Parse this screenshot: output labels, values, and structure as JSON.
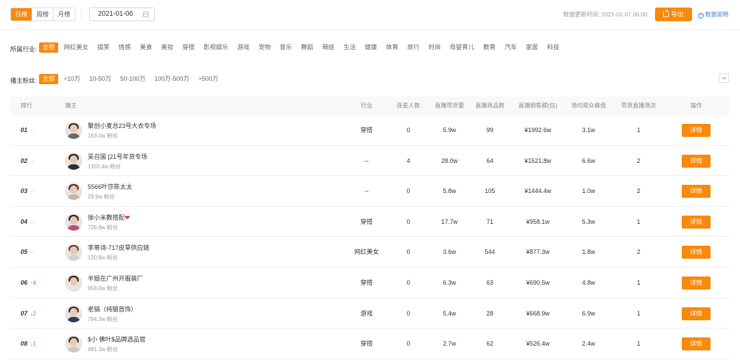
{
  "toolbar": {
    "tabs": [
      {
        "label": "日榜",
        "active": true
      },
      {
        "label": "周榜",
        "active": false
      },
      {
        "label": "月榜",
        "active": false
      }
    ],
    "date": "2021-01-06",
    "update_label": "数据更新时间:",
    "update_time": "2021-01-07 06:00",
    "export_label": "导出",
    "help_label": "数据说明"
  },
  "industry": {
    "label": "所属行业:",
    "options": [
      "全部",
      "网红美女",
      "搞笑",
      "情感",
      "美食",
      "美妆",
      "穿搭",
      "影视娱乐",
      "游戏",
      "宠物",
      "音乐",
      "舞蹈",
      "萌娃",
      "生活",
      "健康",
      "体育",
      "旅行",
      "时尚",
      "母婴育儿",
      "教育",
      "汽车",
      "家居",
      "科技"
    ],
    "selected": "全部"
  },
  "fans": {
    "label": "播主粉丝:",
    "options": [
      "全部",
      "<10万",
      "10-50万",
      "50-100万",
      "100万-500万",
      ">500万"
    ],
    "selected": "全部"
  },
  "table": {
    "headers": {
      "rank": "排行",
      "streamer": "播主",
      "industry": "行业",
      "mic": "连麦人数",
      "goods": "直播带货量",
      "items": "直播商品数",
      "sales": "直播销售额(估)",
      "peak": "场均观众峰值",
      "sessions": "带货直播场次",
      "action": "操作"
    },
    "rows": [
      {
        "rank": "01",
        "trend": "--",
        "trend_dir": "flat",
        "name": "聚创小麦总23号大衣专场",
        "fans": "163.0w 粉丝",
        "industry": "穿搭",
        "mic": "0",
        "goods": "5.9w",
        "items": "99",
        "sales": "¥1992.6w",
        "peak": "3.1w",
        "sessions": "1",
        "action": "详情"
      },
      {
        "rank": "02",
        "trend": "--",
        "trend_dir": "flat",
        "name": "吴召国 [21号年货专场",
        "fans": "1355.4w 粉丝",
        "industry": "--",
        "mic": "4",
        "goods": "28.0w",
        "items": "64",
        "sales": "¥1521.8w",
        "peak": "6.6w",
        "sessions": "2",
        "action": "详情"
      },
      {
        "rank": "03",
        "trend": "--",
        "trend_dir": "flat",
        "name": "5566叶莎陈太太",
        "fans": "29.9w 粉丝",
        "industry": "--",
        "mic": "0",
        "goods": "5.8w",
        "items": "105",
        "sales": "¥1444.4w",
        "peak": "1.0w",
        "sessions": "2",
        "action": "详情"
      },
      {
        "rank": "04",
        "trend": "--",
        "trend_dir": "flat",
        "name": "徐小米教搭配",
        "heart": "❤",
        "fans": "726.8w 粉丝",
        "industry": "穿搭",
        "mic": "0",
        "goods": "17.7w",
        "items": "71",
        "sales": "¥958.1w",
        "peak": "5.3w",
        "sessions": "1",
        "action": "详情"
      },
      {
        "rank": "05",
        "trend": "--",
        "trend_dir": "flat",
        "name": "李蒂诗-717皮草供应链",
        "fans": "120.8w 粉丝",
        "industry": "网红美女",
        "mic": "0",
        "goods": "3.6w",
        "items": "544",
        "sales": "¥877.3w",
        "peak": "1.8w",
        "sessions": "2",
        "action": "详情"
      },
      {
        "rank": "06",
        "trend": "↑4",
        "trend_dir": "up",
        "name": "半姐在广州开服装厂",
        "fans": "958.0w 粉丝",
        "industry": "穿搭",
        "mic": "0",
        "goods": "6.3w",
        "items": "63",
        "sales": "¥690.5w",
        "peak": "4.8w",
        "sessions": "1",
        "action": "详情"
      },
      {
        "rank": "07",
        "trend": "↓2",
        "trend_dir": "down",
        "name": "老锅（纯银首饰）",
        "fans": "794.3w 粉丝",
        "industry": "游戏",
        "mic": "0",
        "goods": "5.4w",
        "items": "28",
        "sales": "¥668.9w",
        "peak": "6.9w",
        "sessions": "1",
        "action": "详情"
      },
      {
        "rank": "08",
        "trend": "↓1",
        "trend_dir": "down",
        "name": "$小 佛叶$品牌选品官",
        "fans": "481.3w 粉丝",
        "industry": "穿搭",
        "mic": "0",
        "goods": "2.7w",
        "items": "62",
        "sales": "¥526.4w",
        "peak": "2.4w",
        "sessions": "1",
        "action": "详情"
      }
    ]
  },
  "colors": {
    "accent": "#f7890c",
    "link": "#3d7fd8",
    "trend_up": "#e84a43",
    "trend_down": "#2aa66b"
  }
}
